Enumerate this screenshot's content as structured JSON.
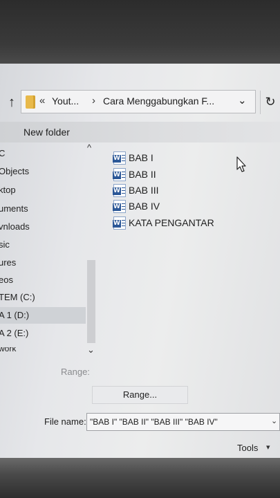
{
  "address_bar": {
    "overflow_chevron": "«",
    "path_part1": "Yout...",
    "separator": "›",
    "path_part2": "Cara Menggabungkan F...",
    "up_icon": "↑",
    "dropdown_icon": "⌄",
    "refresh_icon": "↻"
  },
  "toolbar": {
    "new_folder": "New folder"
  },
  "nav_pane": {
    "items": [
      {
        "label": "C"
      },
      {
        "label": "Objects"
      },
      {
        "label": "ktop"
      },
      {
        "label": "uments"
      },
      {
        "label": "vnloads"
      },
      {
        "label": "sic"
      },
      {
        "label": "ures"
      },
      {
        "label": "eos"
      },
      {
        "label": "TEM (C:)"
      },
      {
        "label": "A 1 (D:)"
      },
      {
        "label": "A 2 (E:)"
      },
      {
        "label": "work"
      }
    ],
    "selected_index": 9,
    "scroll_up_icon": "^",
    "scroll_down_icon": "⌄"
  },
  "files": [
    {
      "name": "BAB I",
      "icon": "word-doc-icon"
    },
    {
      "name": "BAB II",
      "icon": "word-doc-icon"
    },
    {
      "name": "BAB III",
      "icon": "word-doc-icon"
    },
    {
      "name": "BAB IV",
      "icon": "word-doc-icon"
    },
    {
      "name": "KATA PENGANTAR",
      "icon": "word-doc-icon"
    }
  ],
  "range": {
    "label": "Range:",
    "button": "Range..."
  },
  "file_name": {
    "label": "File name:",
    "value": "\"BAB I\" \"BAB II\" \"BAB III\" \"BAB IV\"",
    "dropdown_icon": "⌄"
  },
  "tools": {
    "label": "Tools",
    "dropdown_icon": "▾"
  },
  "colors": {
    "word_blue": "#2b5797",
    "folder_yellow": "#e8b94a",
    "selected_bg": "#cfd2d6"
  }
}
